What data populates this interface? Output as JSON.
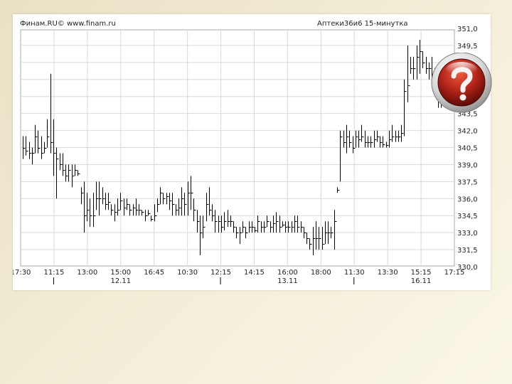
{
  "header": {
    "source": "Финам.RU© www.finam.ru",
    "instrument": "Аптеки36и6 15-минутка"
  },
  "help_icon": {
    "name": "help-question-icon",
    "color": "#b3241a"
  },
  "chart_data": {
    "type": "ohlc",
    "title": "Аптеки36и6 15-минутка",
    "ylim": [
      330.0,
      351.0
    ],
    "y_ticks": [
      351.0,
      349.5,
      348.0,
      346.5,
      345.0,
      343.5,
      342.0,
      340.5,
      339.0,
      337.5,
      336.0,
      334.5,
      333.0,
      331.5,
      330.0
    ],
    "y_tick_labels": [
      "351,0",
      "349,5",
      "348,0",
      "346,5",
      "345,0",
      "343,5",
      "342,0",
      "340,5",
      "339,0",
      "337,5",
      "336,0",
      "334,5",
      "333,0",
      "331,5",
      "330,0"
    ],
    "x_ticks": [
      "17:30",
      "11:15",
      "13:00",
      "15:00",
      "16:45",
      "10:30",
      "12:15",
      "14:15",
      "16:00",
      "18:00",
      "11:30",
      "13:30",
      "15:15",
      "17:15"
    ],
    "date_labels": [
      "12.11",
      "13.11",
      "16.11"
    ],
    "grid": true,
    "bars": [
      [
        341.5,
        339.5,
        340.5
      ],
      [
        341.5,
        339.8,
        340.2
      ],
      [
        341.0,
        339.5,
        340.0
      ],
      [
        340.5,
        339.0,
        340.0
      ],
      [
        342.5,
        340.0,
        341.5
      ],
      [
        342.0,
        340.0,
        340.5
      ],
      [
        341.5,
        339.5,
        340.0
      ],
      [
        341.0,
        340.0,
        340.5
      ],
      [
        343.0,
        340.5,
        341.5
      ],
      [
        347.0,
        340.0,
        341.0
      ],
      [
        343.0,
        338.0,
        340.0
      ],
      [
        340.5,
        336.0,
        339.5
      ],
      [
        340.0,
        338.5,
        339.0
      ],
      [
        340.0,
        338.0,
        338.5
      ],
      [
        339.0,
        337.5,
        338.0
      ],
      [
        339.0,
        337.5,
        338.5
      ],
      [
        339.0,
        337.0,
        338.0
      ],
      [
        339.0,
        338.0,
        338.5
      ],
      [
        338.5,
        338.0,
        338.2
      ],
      [
        337.0,
        335.5,
        336.5
      ],
      [
        337.5,
        333.0,
        334.5
      ],
      [
        336.5,
        334.0,
        335.0
      ],
      [
        336.0,
        333.5,
        334.5
      ],
      [
        336.5,
        333.5,
        334.5
      ],
      [
        337.5,
        335.0,
        336.0
      ],
      [
        337.5,
        334.5,
        336.0
      ],
      [
        337.0,
        335.5,
        336.0
      ],
      [
        336.5,
        335.0,
        335.5
      ],
      [
        336.5,
        335.0,
        335.7
      ],
      [
        335.5,
        334.5,
        335.0
      ],
      [
        335.5,
        334.0,
        334.8
      ],
      [
        336.0,
        334.5,
        335.0
      ],
      [
        336.5,
        335.0,
        335.8
      ],
      [
        336.0,
        334.5,
        335.2
      ],
      [
        336.0,
        335.0,
        335.5
      ],
      [
        335.5,
        334.5,
        335.0
      ],
      [
        335.5,
        334.5,
        335.2
      ],
      [
        336.0,
        334.5,
        335.0
      ],
      [
        335.5,
        334.5,
        335.0
      ],
      [
        335.0,
        334.5,
        334.8
      ],
      [
        335.0,
        334.0,
        334.5
      ],
      [
        335.0,
        334.5,
        334.7
      ],
      [
        334.5,
        334.0,
        334.2
      ],
      [
        335.5,
        334.0,
        334.5
      ],
      [
        336.0,
        334.8,
        335.5
      ],
      [
        337.0,
        335.5,
        336.5
      ],
      [
        336.5,
        335.5,
        336.0
      ],
      [
        336.5,
        335.5,
        336.2
      ],
      [
        336.5,
        335.0,
        335.8
      ],
      [
        336.5,
        334.5,
        335.5
      ],
      [
        335.5,
        334.5,
        335.0
      ],
      [
        336.0,
        334.5,
        335.2
      ],
      [
        337.0,
        334.5,
        336.0
      ],
      [
        336.5,
        334.5,
        335.5
      ],
      [
        337.5,
        334.5,
        336.5
      ],
      [
        338.0,
        335.0,
        336.5
      ],
      [
        336.0,
        334.0,
        335.0
      ],
      [
        335.0,
        333.0,
        334.0
      ],
      [
        334.5,
        331.0,
        333.0
      ],
      [
        334.5,
        332.5,
        333.5
      ],
      [
        336.5,
        334.0,
        335.5
      ],
      [
        337.0,
        334.5,
        335.0
      ],
      [
        335.5,
        334.0,
        334.5
      ],
      [
        335.0,
        333.0,
        334.0
      ],
      [
        334.5,
        333.0,
        334.0
      ],
      [
        334.5,
        333.0,
        333.5
      ],
      [
        334.8,
        333.2,
        334.0
      ],
      [
        335.0,
        333.5,
        334.0
      ],
      [
        334.5,
        333.5,
        334.0
      ],
      [
        334.0,
        333.0,
        333.5
      ],
      [
        333.5,
        332.5,
        333.0
      ],
      [
        333.5,
        332.0,
        333.0
      ],
      [
        334.0,
        333.0,
        333.5
      ],
      [
        333.5,
        332.5,
        333.0
      ],
      [
        334.0,
        333.0,
        333.5
      ],
      [
        334.0,
        333.0,
        333.5
      ],
      [
        333.5,
        333.0,
        333.2
      ],
      [
        334.5,
        333.0,
        334.0
      ],
      [
        334.0,
        333.0,
        333.5
      ],
      [
        334.0,
        333.0,
        333.5
      ],
      [
        334.5,
        333.5,
        334.0
      ],
      [
        334.0,
        333.0,
        333.5
      ],
      [
        334.5,
        333.0,
        333.8
      ],
      [
        334.8,
        333.0,
        334.0
      ],
      [
        334.5,
        333.0,
        333.5
      ],
      [
        334.0,
        333.5,
        333.7
      ],
      [
        334.0,
        333.0,
        333.5
      ],
      [
        334.0,
        333.0,
        333.5
      ],
      [
        334.0,
        333.0,
        333.5
      ],
      [
        334.5,
        333.0,
        334.0
      ],
      [
        334.5,
        333.0,
        333.5
      ],
      [
        334.0,
        333.0,
        333.5
      ],
      [
        333.5,
        332.5,
        333.0
      ],
      [
        333.0,
        332.0,
        332.5
      ],
      [
        332.5,
        331.5,
        332.0
      ],
      [
        333.5,
        331.0,
        332.5
      ],
      [
        334.0,
        331.5,
        332.5
      ],
      [
        333.5,
        331.5,
        332.5
      ],
      [
        333.5,
        331.5,
        332.0
      ],
      [
        334.0,
        332.0,
        333.0
      ],
      [
        334.0,
        332.0,
        333.0
      ],
      [
        333.5,
        332.5,
        333.0
      ],
      [
        335.0,
        331.5,
        334.0
      ],
      [
        337.0,
        336.5,
        336.8
      ],
      [
        342.0,
        337.5,
        341.5
      ],
      [
        342.0,
        340.5,
        341.0
      ],
      [
        342.5,
        340.0,
        341.5
      ],
      [
        342.0,
        340.5,
        341.0
      ],
      [
        341.5,
        340.0,
        340.5
      ],
      [
        342.0,
        340.5,
        341.5
      ],
      [
        342.0,
        340.5,
        341.2
      ],
      [
        342.5,
        341.0,
        341.5
      ],
      [
        342.0,
        340.5,
        341.0
      ],
      [
        341.5,
        340.5,
        341.0
      ],
      [
        341.5,
        340.5,
        341.0
      ],
      [
        342.0,
        340.5,
        341.2
      ],
      [
        342.0,
        341.0,
        341.5
      ],
      [
        341.5,
        340.5,
        341.0
      ],
      [
        341.5,
        340.5,
        340.8
      ],
      [
        341.0,
        340.5,
        340.7
      ],
      [
        342.0,
        340.5,
        341.2
      ],
      [
        342.5,
        341.0,
        341.5
      ],
      [
        342.0,
        341.0,
        341.5
      ],
      [
        342.0,
        341.0,
        341.5
      ],
      [
        342.5,
        341.0,
        341.8
      ],
      [
        346.5,
        341.5,
        345.5
      ],
      [
        349.5,
        344.5,
        346.0
      ],
      [
        348.5,
        347.0,
        347.5
      ],
      [
        348.5,
        346.5,
        347.5
      ],
      [
        349.5,
        346.5,
        348.5
      ],
      [
        350.0,
        347.0,
        349.0
      ],
      [
        349.0,
        347.5,
        348.0
      ],
      [
        348.5,
        347.0,
        347.5
      ],
      [
        348.0,
        346.5,
        347.5
      ],
      [
        348.5,
        346.0,
        347.0
      ],
      [
        347.5,
        345.5,
        346.5
      ],
      [
        346.5,
        344.0,
        345.5
      ],
      [
        345.5,
        344.0,
        345.0
      ]
    ]
  }
}
